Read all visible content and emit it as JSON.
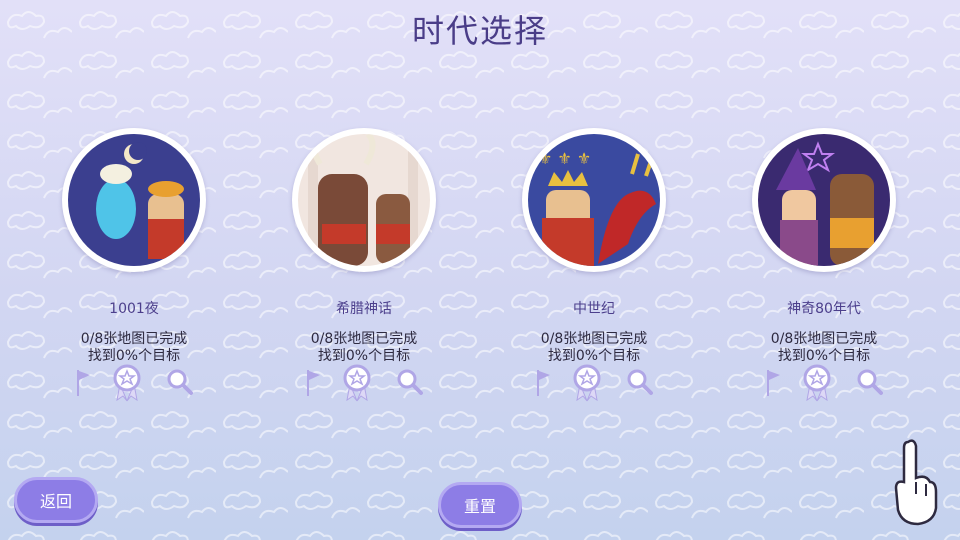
{
  "screen": {
    "title": "时代选择"
  },
  "eras": [
    {
      "name": "1001夜",
      "maps": "0/8张地图已完成",
      "targets": "找到0%个目标"
    },
    {
      "name": "希腊神话",
      "maps": "0/8张地图已完成",
      "targets": "找到0%个目标"
    },
    {
      "name": "中世纪",
      "maps": "0/8张地图已完成",
      "targets": "找到0%个目标"
    },
    {
      "name": "神奇80年代",
      "maps": "0/8张地图已完成",
      "targets": "找到0%个目标"
    }
  ],
  "buttons": {
    "back": "返回",
    "reset": "重置"
  },
  "icons": [
    "flag-icon",
    "award-ribbon-icon",
    "magnifier-icon",
    "pointing-hand-icon"
  ],
  "colors": {
    "accent": "#8d7de6",
    "title": "#4a3d88",
    "icon": "#b0a6e6"
  }
}
